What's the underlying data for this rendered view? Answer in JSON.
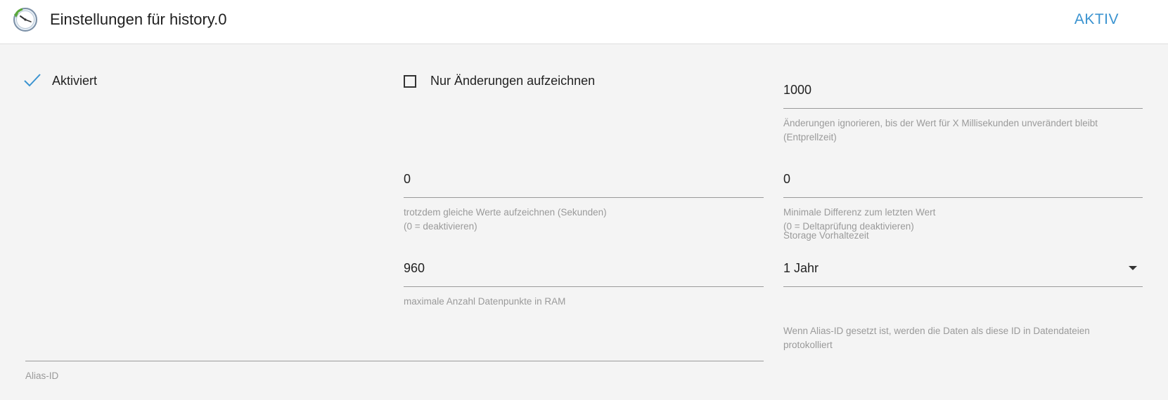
{
  "header": {
    "title": "Einstellungen für history.0",
    "status_label": "AKTIV",
    "app_icon": "clock-history-icon"
  },
  "colors": {
    "accent": "#3a93d0",
    "background": "#f4f4f4",
    "header_bg": "#ffffff",
    "helper_text": "#9a9a9a",
    "underline": "#9a9a9a"
  },
  "settings": {
    "enabled": {
      "label": "Aktiviert",
      "checked": true
    },
    "changes_only": {
      "label": "Nur Änderungen aufzeichnen",
      "checked": false
    },
    "debounce": {
      "value": "1000",
      "helper_line1": "Änderungen ignorieren, bis der Wert für X Millisekunden unverändert bleibt",
      "helper_line2": "(Entprellzeit)"
    },
    "record_same_values": {
      "value": "0",
      "helper_line1": "trotzdem gleiche Werte aufzeichnen (Sekunden)",
      "helper_line2": "(0 = deaktivieren)"
    },
    "min_difference": {
      "value": "0",
      "helper_line1": "Minimale Differenz zum letzten Wert",
      "helper_line2": "(0 = Deltaprüfung deaktivieren)"
    },
    "max_ram_points": {
      "value": "960",
      "helper": "maximale Anzahl Datenpunkte in RAM"
    },
    "retention": {
      "label": "Storage Vorhaltezeit",
      "selected": "1 Jahr"
    },
    "alias_id": {
      "value": "",
      "label": "Alias-ID",
      "helper_line1": "Wenn Alias-ID gesetzt ist, werden die Daten als diese ID in Datendateien",
      "helper_line2": "protokolliert"
    }
  }
}
